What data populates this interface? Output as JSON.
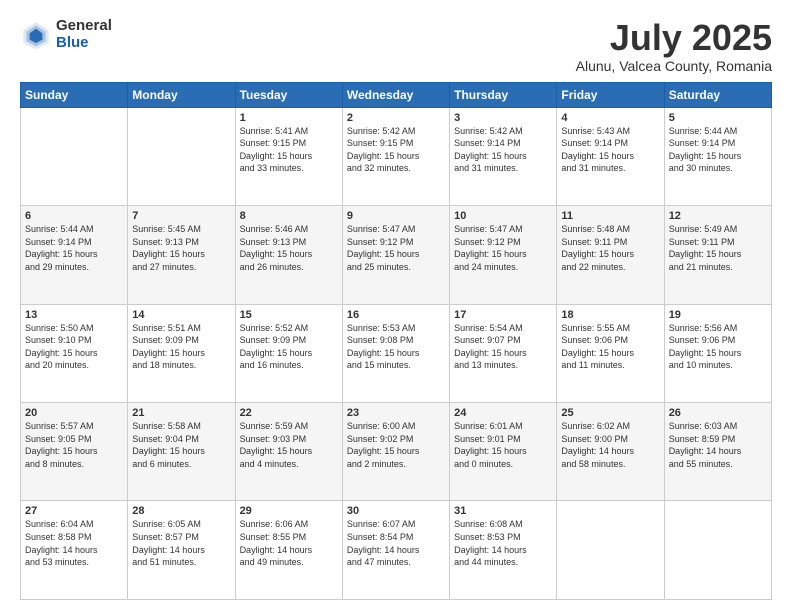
{
  "header": {
    "logo_general": "General",
    "logo_blue": "Blue",
    "main_title": "July 2025",
    "subtitle": "Alunu, Valcea County, Romania"
  },
  "calendar": {
    "headers": [
      "Sunday",
      "Monday",
      "Tuesday",
      "Wednesday",
      "Thursday",
      "Friday",
      "Saturday"
    ],
    "rows": [
      [
        {
          "day": "",
          "content": ""
        },
        {
          "day": "",
          "content": ""
        },
        {
          "day": "1",
          "content": "Sunrise: 5:41 AM\nSunset: 9:15 PM\nDaylight: 15 hours\nand 33 minutes."
        },
        {
          "day": "2",
          "content": "Sunrise: 5:42 AM\nSunset: 9:15 PM\nDaylight: 15 hours\nand 32 minutes."
        },
        {
          "day": "3",
          "content": "Sunrise: 5:42 AM\nSunset: 9:14 PM\nDaylight: 15 hours\nand 31 minutes."
        },
        {
          "day": "4",
          "content": "Sunrise: 5:43 AM\nSunset: 9:14 PM\nDaylight: 15 hours\nand 31 minutes."
        },
        {
          "day": "5",
          "content": "Sunrise: 5:44 AM\nSunset: 9:14 PM\nDaylight: 15 hours\nand 30 minutes."
        }
      ],
      [
        {
          "day": "6",
          "content": "Sunrise: 5:44 AM\nSunset: 9:14 PM\nDaylight: 15 hours\nand 29 minutes."
        },
        {
          "day": "7",
          "content": "Sunrise: 5:45 AM\nSunset: 9:13 PM\nDaylight: 15 hours\nand 27 minutes."
        },
        {
          "day": "8",
          "content": "Sunrise: 5:46 AM\nSunset: 9:13 PM\nDaylight: 15 hours\nand 26 minutes."
        },
        {
          "day": "9",
          "content": "Sunrise: 5:47 AM\nSunset: 9:12 PM\nDaylight: 15 hours\nand 25 minutes."
        },
        {
          "day": "10",
          "content": "Sunrise: 5:47 AM\nSunset: 9:12 PM\nDaylight: 15 hours\nand 24 minutes."
        },
        {
          "day": "11",
          "content": "Sunrise: 5:48 AM\nSunset: 9:11 PM\nDaylight: 15 hours\nand 22 minutes."
        },
        {
          "day": "12",
          "content": "Sunrise: 5:49 AM\nSunset: 9:11 PM\nDaylight: 15 hours\nand 21 minutes."
        }
      ],
      [
        {
          "day": "13",
          "content": "Sunrise: 5:50 AM\nSunset: 9:10 PM\nDaylight: 15 hours\nand 20 minutes."
        },
        {
          "day": "14",
          "content": "Sunrise: 5:51 AM\nSunset: 9:09 PM\nDaylight: 15 hours\nand 18 minutes."
        },
        {
          "day": "15",
          "content": "Sunrise: 5:52 AM\nSunset: 9:09 PM\nDaylight: 15 hours\nand 16 minutes."
        },
        {
          "day": "16",
          "content": "Sunrise: 5:53 AM\nSunset: 9:08 PM\nDaylight: 15 hours\nand 15 minutes."
        },
        {
          "day": "17",
          "content": "Sunrise: 5:54 AM\nSunset: 9:07 PM\nDaylight: 15 hours\nand 13 minutes."
        },
        {
          "day": "18",
          "content": "Sunrise: 5:55 AM\nSunset: 9:06 PM\nDaylight: 15 hours\nand 11 minutes."
        },
        {
          "day": "19",
          "content": "Sunrise: 5:56 AM\nSunset: 9:06 PM\nDaylight: 15 hours\nand 10 minutes."
        }
      ],
      [
        {
          "day": "20",
          "content": "Sunrise: 5:57 AM\nSunset: 9:05 PM\nDaylight: 15 hours\nand 8 minutes."
        },
        {
          "day": "21",
          "content": "Sunrise: 5:58 AM\nSunset: 9:04 PM\nDaylight: 15 hours\nand 6 minutes."
        },
        {
          "day": "22",
          "content": "Sunrise: 5:59 AM\nSunset: 9:03 PM\nDaylight: 15 hours\nand 4 minutes."
        },
        {
          "day": "23",
          "content": "Sunrise: 6:00 AM\nSunset: 9:02 PM\nDaylight: 15 hours\nand 2 minutes."
        },
        {
          "day": "24",
          "content": "Sunrise: 6:01 AM\nSunset: 9:01 PM\nDaylight: 15 hours\nand 0 minutes."
        },
        {
          "day": "25",
          "content": "Sunrise: 6:02 AM\nSunset: 9:00 PM\nDaylight: 14 hours\nand 58 minutes."
        },
        {
          "day": "26",
          "content": "Sunrise: 6:03 AM\nSunset: 8:59 PM\nDaylight: 14 hours\nand 55 minutes."
        }
      ],
      [
        {
          "day": "27",
          "content": "Sunrise: 6:04 AM\nSunset: 8:58 PM\nDaylight: 14 hours\nand 53 minutes."
        },
        {
          "day": "28",
          "content": "Sunrise: 6:05 AM\nSunset: 8:57 PM\nDaylight: 14 hours\nand 51 minutes."
        },
        {
          "day": "29",
          "content": "Sunrise: 6:06 AM\nSunset: 8:55 PM\nDaylight: 14 hours\nand 49 minutes."
        },
        {
          "day": "30",
          "content": "Sunrise: 6:07 AM\nSunset: 8:54 PM\nDaylight: 14 hours\nand 47 minutes."
        },
        {
          "day": "31",
          "content": "Sunrise: 6:08 AM\nSunset: 8:53 PM\nDaylight: 14 hours\nand 44 minutes."
        },
        {
          "day": "",
          "content": ""
        },
        {
          "day": "",
          "content": ""
        }
      ]
    ]
  }
}
